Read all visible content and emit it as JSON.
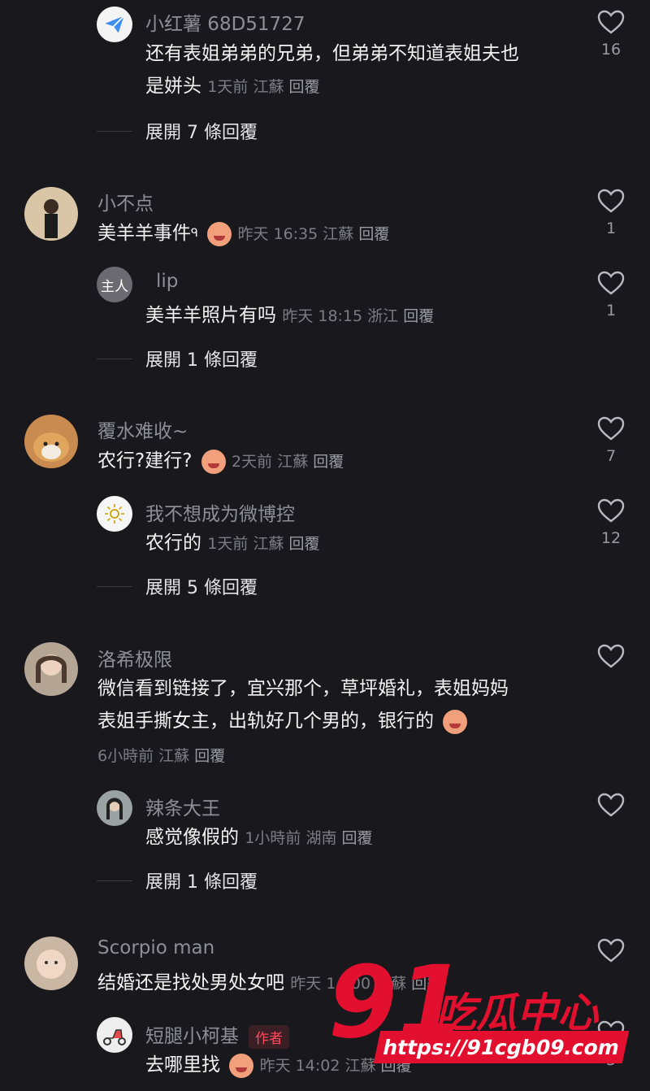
{
  "colors": {
    "background": "#18181d",
    "author_badge": "#ff4b5f",
    "watermark": "#e2102e"
  },
  "comments": [
    {
      "name": "小红薯 68D51727",
      "text_lines": [
        "还有表姐弟弟的兄弟，但弟弟不知道表姐夫也",
        "是姘头"
      ],
      "time": "1天前",
      "location": "江蘇",
      "reply": "回覆",
      "likes": "16",
      "expand": "展開 7 條回覆"
    },
    {
      "name": "小不点",
      "text": "美羊羊事件",
      "time": "昨天 16:35",
      "location": "江蘇",
      "reply": "回覆",
      "likes": "1",
      "sub": {
        "avatar_text": "主人",
        "name": "lip",
        "text": "美羊羊照片有吗",
        "time": "昨天 18:15",
        "location": "浙江",
        "reply": "回覆",
        "likes": "1"
      },
      "expand": "展開 1 條回覆"
    },
    {
      "name": "覆水难收~",
      "text": "农行?建行?",
      "time": "2天前",
      "location": "江蘇",
      "reply": "回覆",
      "likes": "7",
      "sub": {
        "name": "我不想成为微博控",
        "text": "农行的",
        "time": "1天前",
        "location": "江蘇",
        "reply": "回覆",
        "likes": "12"
      },
      "expand": "展開 5 條回覆"
    },
    {
      "name": "洛希极限",
      "text_lines": [
        "微信看到链接了，宜兴那个，草坪婚礼，表姐妈妈",
        "表姐手撕女主，出轨好几个男的，银行的"
      ],
      "time": "6小時前",
      "location": "江蘇",
      "reply": "回覆",
      "sub": {
        "name": "辣条大王",
        "text": "感觉像假的",
        "time": "1小時前",
        "location": "湖南",
        "reply": "回覆"
      },
      "expand": "展開 1 條回覆"
    },
    {
      "name": "Scorpio man",
      "text": "结婚还是找处男处女吧",
      "time": "昨天 14:00",
      "location": "江蘇",
      "reply": "回覆",
      "sub": {
        "name": "短腿小柯基",
        "badge": "作者",
        "text": "去哪里找",
        "time": "昨天 14:02",
        "location": "江蘇",
        "reply": "回覆",
        "likes": "3"
      }
    }
  ],
  "watermark": {
    "number": "91",
    "text": "吃瓜中心",
    "url": "https://91cgb09.com"
  }
}
